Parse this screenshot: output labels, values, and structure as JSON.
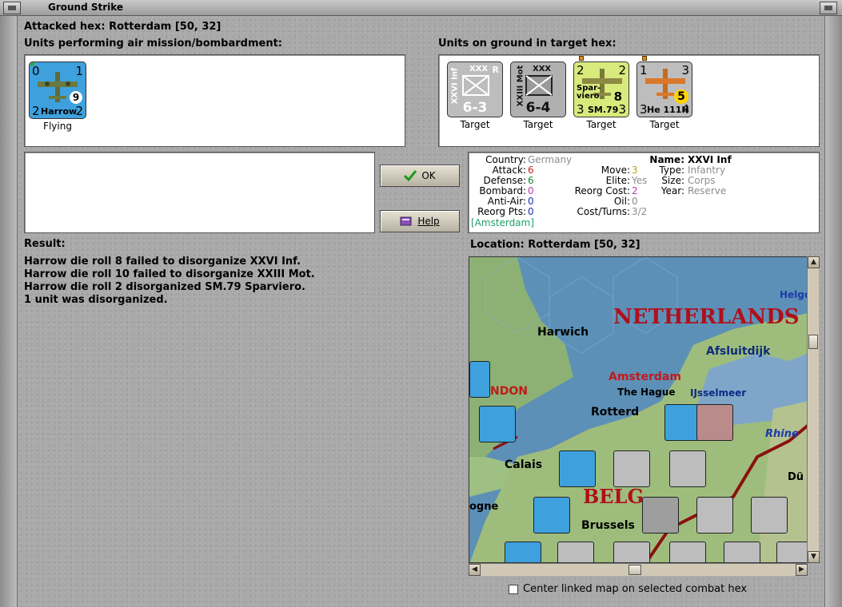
{
  "window": {
    "title": "Ground Strike"
  },
  "attacked_hex": "Attacked hex: Rotterdam  [50, 32]",
  "air_units": {
    "heading": "Units performing air mission/bombardment:",
    "units": [
      {
        "name": "Harrow",
        "top_left": "0",
        "top_right": "1",
        "bottom_left": "2",
        "bottom_right": "2",
        "badge": "9",
        "status": "Flying"
      }
    ]
  },
  "ground_units": {
    "heading": "Units on ground in target hex:",
    "units": [
      {
        "side_label": "XXVI Inf",
        "size": "XXX",
        "marker": "R",
        "value": "6-3",
        "status": "Target",
        "color": "#bdbdbd"
      },
      {
        "side_label": "XXIII Mot",
        "size": "XXX",
        "value": "6-4",
        "status": "Target",
        "color": "#b0b0b0"
      },
      {
        "name_lines": "Spar-\nviero",
        "type": "SM.79",
        "top_left": "2",
        "top_right": "2",
        "bottom_left": "3",
        "bottom_right": "3",
        "badge": "8",
        "status": "Target",
        "color": "#d8ea7c"
      },
      {
        "type": "He 111H",
        "top_left": "1",
        "top_right": "3",
        "bottom_left": "3",
        "bottom_right": "4",
        "badge": "5",
        "status": "Target",
        "color": "#bdbdbd"
      }
    ]
  },
  "buttons": {
    "ok": "OK",
    "help": "Help"
  },
  "unit_info": {
    "country_label": "Country:",
    "country": "Germany",
    "attack_label": "Attack:",
    "attack": "6",
    "defense_label": "Defense:",
    "defense": "6",
    "bombard_label": "Bombard:",
    "bombard": "0",
    "antiair_label": "Anti-Air:",
    "antiair": "0",
    "reorg_pts_label": "Reorg Pts:",
    "reorg_pts": "0",
    "home": "[Amsterdam]",
    "move_label": "Move:",
    "move": "3",
    "elite_label": "Elite:",
    "elite": "Yes",
    "reorg_cost_label": "Reorg Cost:",
    "reorg_cost": "2",
    "oil_label": "Oil:",
    "oil": "0",
    "cost_turns_label": "Cost/Turns:",
    "cost_turns": "3/2",
    "name_label": "Name:",
    "name": "XXVI Inf",
    "type_label": "Type:",
    "type": "Infantry",
    "size_label": "Size:",
    "size": "Corps",
    "year_label": "Year:",
    "year": "Reserve"
  },
  "result": {
    "heading": "Result:",
    "lines": [
      "Harrow die roll 8 failed to disorganize XXVI Inf.",
      "Harrow die roll 10 failed to disorganize XXIII Mot.",
      "Harrow die roll 2 disorganized SM.79 Sparviero.",
      "1 unit was disorganized."
    ]
  },
  "location": "Location:  Rotterdam  [50, 32]",
  "map": {
    "labels": {
      "netherlands": "NETHERLANDS",
      "harwich": "Harwich",
      "afsluitdijk": "Afsluitdijk",
      "amsterdam": "Amsterdam",
      "the_hague": "The Hague",
      "ijsselmeer": "IJsselmeer",
      "rotterdam": "Rotterd",
      "london": "NDON",
      "calais": "Calais",
      "brussels": "Brussels",
      "belgium": "BELG",
      "rhine": "Rhine",
      "helgo": "Helgo",
      "ogne": "ogne",
      "du": "Dü"
    }
  },
  "center_checkbox": {
    "label": "Center linked map on selected combat hex",
    "checked": false
  }
}
